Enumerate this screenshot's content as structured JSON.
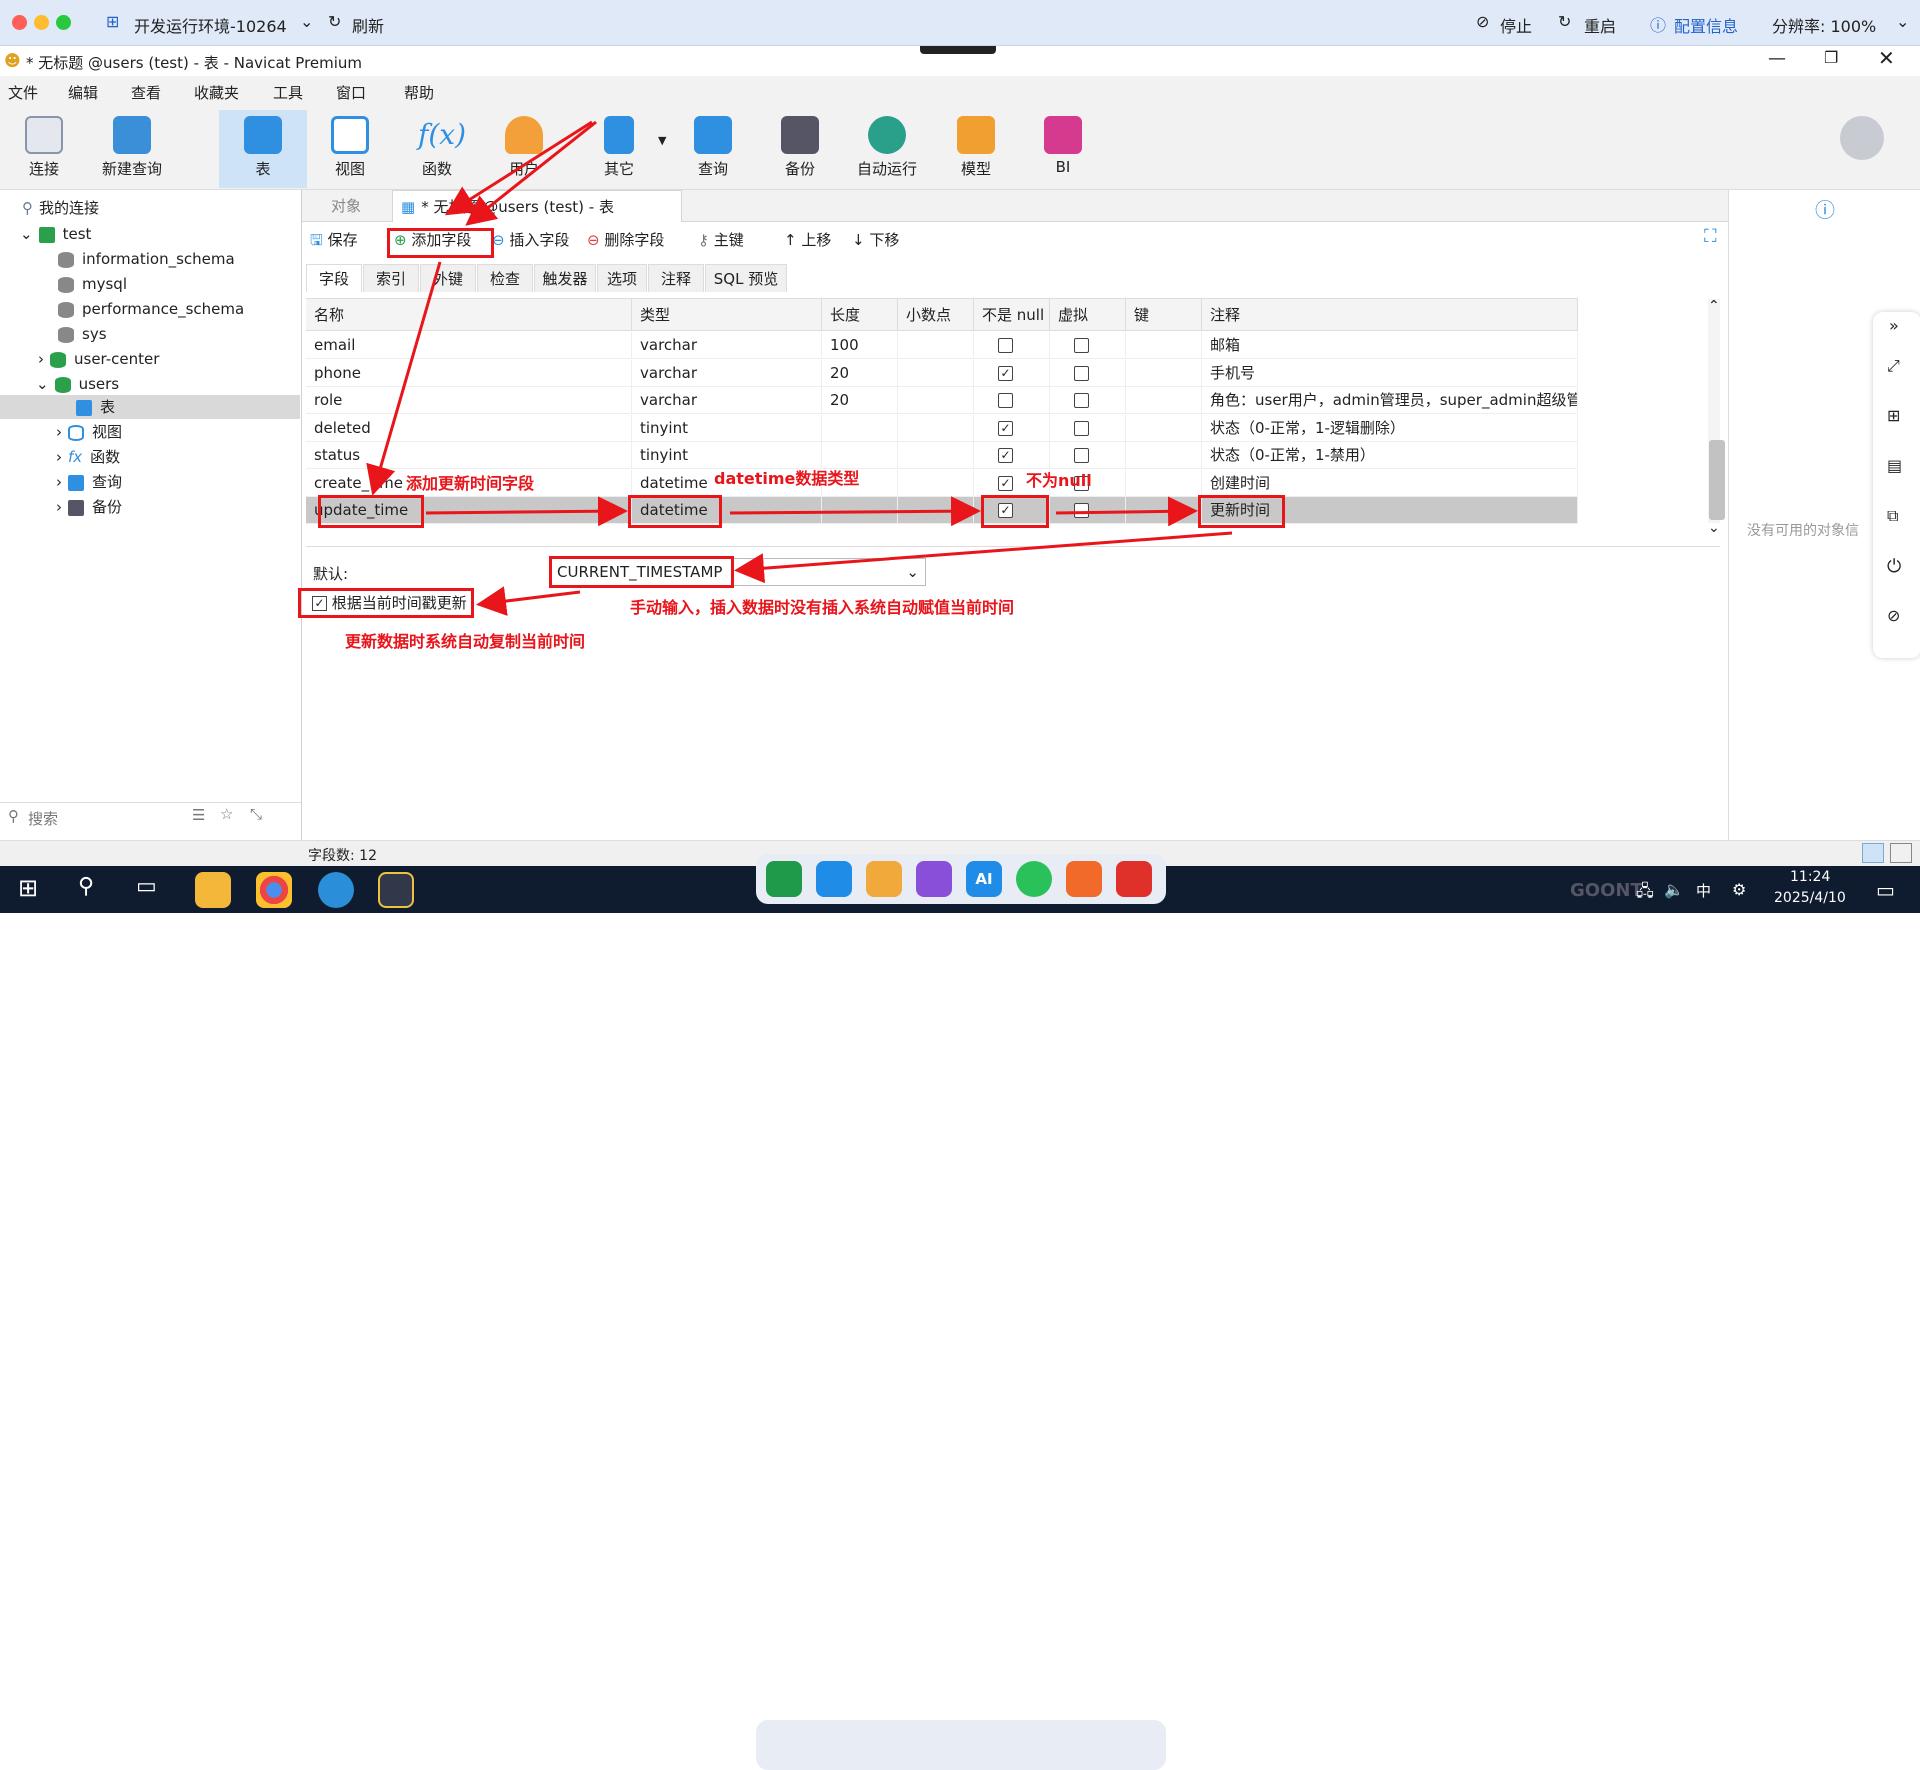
{
  "outer": {
    "env_title": "开发运行环境-10264",
    "refresh": "刷新",
    "stop": "停止",
    "restart": "重启",
    "config": "配置信息",
    "resolution": "分辨率: 100%"
  },
  "window": {
    "title": "* 无标题 @users (test) - 表 - Navicat Premium"
  },
  "menu": [
    "文件",
    "编辑",
    "查看",
    "收藏夹",
    "工具",
    "窗口",
    "帮助"
  ],
  "toolbar": [
    {
      "label": "连接",
      "icon": "plug-icon",
      "color": "#5a6a80"
    },
    {
      "label": "新建查询",
      "icon": "new-query-icon",
      "color": "#3b8ed8"
    },
    {
      "label": "表",
      "icon": "table-icon",
      "color": "#2f8fe0"
    },
    {
      "label": "视图",
      "icon": "view-icon",
      "color": "#2f8fe0"
    },
    {
      "label": "函数",
      "icon": "function-icon",
      "color": "#2f8fe0"
    },
    {
      "label": "用户",
      "icon": "user-icon",
      "color": "#f3a03b"
    },
    {
      "label": "其它",
      "icon": "tools-icon",
      "color": "#2f8fe0"
    },
    {
      "label": "查询",
      "icon": "query-icon",
      "color": "#2f8fe0"
    },
    {
      "label": "备份",
      "icon": "backup-icon",
      "color": "#556"
    },
    {
      "label": "自动运行",
      "icon": "robot-icon",
      "color": "#2aa08a"
    },
    {
      "label": "模型",
      "icon": "model-icon",
      "color": "#f0a030"
    },
    {
      "label": "BI",
      "icon": "bi-icon",
      "color": "#d63a8e"
    }
  ],
  "sidebar": {
    "header": "我的连接",
    "items": [
      "test",
      "information_schema",
      "mysql",
      "performance_schema",
      "sys",
      "user-center",
      "users",
      "表",
      "视图",
      "函数",
      "查询",
      "备份"
    ],
    "search_placeholder": "搜索"
  },
  "tabs": {
    "object": "对象",
    "active": "* 无标题 @users (test) - 表"
  },
  "subtoolbar": {
    "save": "保存",
    "add_field": "添加字段",
    "insert_field": "插入字段",
    "delete_field": "删除字段",
    "primary_key": "主键",
    "move_up": "上移",
    "move_down": "下移"
  },
  "subtabs": [
    "字段",
    "索引",
    "外键",
    "检查",
    "触发器",
    "选项",
    "注释",
    "SQL 预览"
  ],
  "grid": {
    "headers": [
      "名称",
      "类型",
      "长度",
      "小数点",
      "不是 null",
      "虚拟",
      "键",
      "注释"
    ],
    "rows": [
      {
        "name": "email",
        "type": "varchar",
        "length": "100",
        "decimal": "",
        "notnull": false,
        "virtual": false,
        "key": "",
        "comment": "邮箱"
      },
      {
        "name": "phone",
        "type": "varchar",
        "length": "20",
        "decimal": "",
        "notnull": true,
        "virtual": false,
        "key": "",
        "comment": "手机号"
      },
      {
        "name": "role",
        "type": "varchar",
        "length": "20",
        "decimal": "",
        "notnull": false,
        "virtual": false,
        "key": "",
        "comment": "角色：user用户，admin管理员，super_admin超级管"
      },
      {
        "name": "deleted",
        "type": "tinyint",
        "length": "",
        "decimal": "",
        "notnull": true,
        "virtual": false,
        "key": "",
        "comment": "状态（0-正常，1-逻辑删除）"
      },
      {
        "name": "status",
        "type": "tinyint",
        "length": "",
        "decimal": "",
        "notnull": true,
        "virtual": false,
        "key": "",
        "comment": "状态（0-正常，1-禁用）"
      },
      {
        "name": "create_time",
        "type": "datetime",
        "length": "",
        "decimal": "",
        "notnull": true,
        "virtual": false,
        "key": "",
        "comment": "创建时间"
      },
      {
        "name": "update_time",
        "type": "datetime",
        "length": "",
        "decimal": "",
        "notnull": true,
        "virtual": false,
        "key": "",
        "comment": "更新时间"
      }
    ]
  },
  "props": {
    "default_label": "默认:",
    "default_value": "CURRENT_TIMESTAMP",
    "on_update_label": "根据当前时间戳更新",
    "on_update_checked": true
  },
  "annotations": {
    "add_update_field": "添加更新时间字段",
    "datetime_type": "datetime数据类型",
    "not_null": "不为null",
    "manual_input": "手动输入，插入数据时没有插入系统自动赋值当前时间",
    "auto_copy": "更新数据时系统自动复制当前时间"
  },
  "rightpanel": {
    "empty": "没有可用的对象信"
  },
  "status": {
    "field_count": "字段数: 12"
  },
  "taskbar": {
    "time": "11:24",
    "date": "2025/4/10",
    "ime": "中",
    "watermark": "GOONT"
  },
  "colors": {
    "accent": "#2f8fe0",
    "annotation": "#e8151b",
    "selected_row": "#c8c8c8"
  }
}
